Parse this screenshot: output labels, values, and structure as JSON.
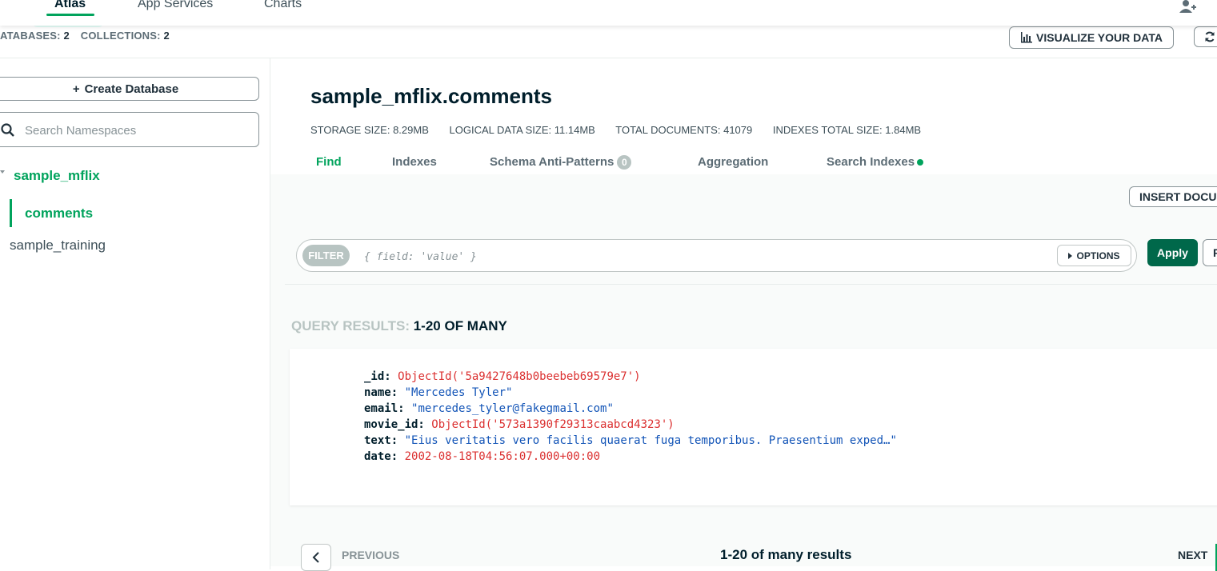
{
  "topnav": {
    "tabs": [
      {
        "label": "Atlas",
        "active": true
      },
      {
        "label": "App Services",
        "active": false
      },
      {
        "label": "Charts",
        "active": false
      }
    ],
    "add_user_icon": "add-user-icon"
  },
  "stats_bar": {
    "databases_label": "ATABASES:",
    "databases_value": "2",
    "collections_label": "COLLECTIONS:",
    "collections_value": "2"
  },
  "toolbar": {
    "visualize_label": "VISUALIZE YOUR DATA",
    "visualize_icon": "bar-chart-icon",
    "refresh_icon": "refresh-icon"
  },
  "sidebar": {
    "create_db_label": "Create Database",
    "search_placeholder": "Search Namespaces",
    "databases": [
      {
        "name": "sample_mflix",
        "expanded": true,
        "collections": [
          "comments"
        ]
      },
      {
        "name": "sample_training",
        "expanded": false,
        "collections": []
      }
    ]
  },
  "collection": {
    "title": "sample_mflix.comments",
    "stats": [
      {
        "label": "STORAGE SIZE:",
        "value": "8.29MB"
      },
      {
        "label": "LOGICAL DATA SIZE:",
        "value": "11.14MB"
      },
      {
        "label": "TOTAL DOCUMENTS:",
        "value": "41079"
      },
      {
        "label": "INDEXES TOTAL SIZE:",
        "value": "1.84MB"
      }
    ],
    "tabs": [
      {
        "label": "Find",
        "active": true
      },
      {
        "label": "Indexes",
        "active": false
      },
      {
        "label": "Schema Anti-Patterns",
        "badge": "0",
        "active": false
      },
      {
        "label": "Aggregation",
        "active": false
      },
      {
        "label": "Search Indexes",
        "active": false
      }
    ]
  },
  "actions": {
    "insert_label": "INSERT DOCUMENT",
    "filter_badge": "FILTER",
    "filter_placeholder": "{ field: 'value' }",
    "options_label": "OPTIONS",
    "apply_label": "Apply",
    "reset_label": "R"
  },
  "results": {
    "label": "QUERY RESULTS:",
    "range": "1-20 OF MANY",
    "document": {
      "_id_key": "_id:",
      "_id": "ObjectId('5a9427648b0beebeb69579e7')",
      "name_key": "name:",
      "name": "\"Mercedes Tyler\"",
      "email_key": "email:",
      "email": "\"mercedes_tyler@fakegmail.com\"",
      "movie_id_key": "movie_id:",
      "movie_id": "ObjectId('573a1390f29313caabcd4323')",
      "text_key": "text:",
      "text": "\"Eius veritatis vero facilis quaerat fuga temporibus. Praesentium exped…\"",
      "date_key": "date:",
      "date": "2002-08-18T04:56:07.000+00:00"
    }
  },
  "pager": {
    "prev_label": "PREVIOUS",
    "summary": "1-20 of many results",
    "next_label": "NEXT"
  },
  "colors": {
    "accent_green": "#00a35c",
    "apply_green": "#00684a",
    "objectid_red": "#db3030",
    "string_blue": "#1254b7"
  }
}
